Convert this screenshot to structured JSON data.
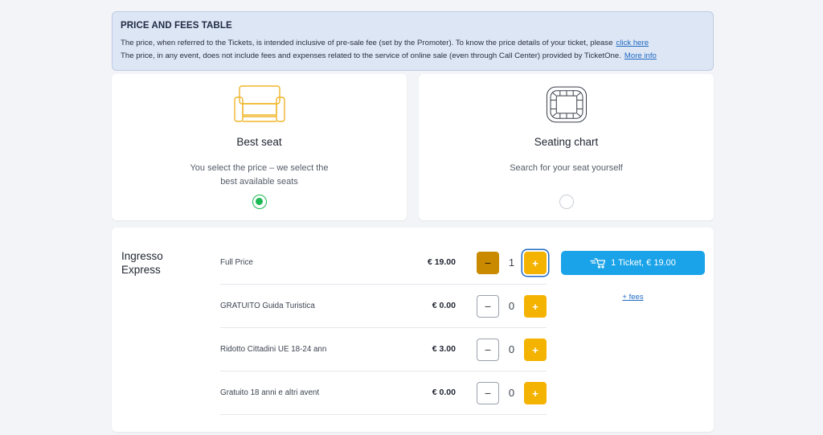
{
  "info": {
    "title": "PRICE AND FEES TABLE",
    "line1": "The price, when referred to the Tickets, is intended inclusive of pre-sale fee (set by the Promoter). To know the price details of your ticket, please",
    "line1_link": "click here",
    "line2": "The price, in any event, does not include fees and expenses related to the service of online sale (even through Call Center) provided by TicketOne.",
    "line2_link": "More info"
  },
  "options": {
    "best_seat": {
      "title": "Best seat",
      "desc_line1": "You select the price – we select the",
      "desc_line2": "best available seats",
      "selected": true,
      "icon": "armchair-icon"
    },
    "seating_chart": {
      "title": "Seating chart",
      "desc_line1": "Search for your seat yourself",
      "selected": false,
      "icon": "stadium-map-icon"
    }
  },
  "tickets": {
    "sector_line1": "Ingresso",
    "sector_line2": "Express",
    "rows": [
      {
        "name": "Full Price",
        "price": "€ 19.00",
        "qty": "1"
      },
      {
        "name": "GRATUITO Guida Turistica",
        "price": "€ 0.00",
        "qty": "0"
      },
      {
        "name": "Ridotto Cittadini UE 18-24 ann",
        "price": "€ 3.00",
        "qty": "0"
      },
      {
        "name": "Gratuito 18 anni e altri avent",
        "price": "€ 0.00",
        "qty": "0"
      }
    ],
    "minus_label": "−",
    "plus_label": "+",
    "buy_label": "1 Ticket, € 19.00",
    "fees_label": "+ fees"
  },
  "colors": {
    "accent_yellow": "#f5b301",
    "buy_blue": "#1aa3e8",
    "selected_green": "#1db954"
  }
}
